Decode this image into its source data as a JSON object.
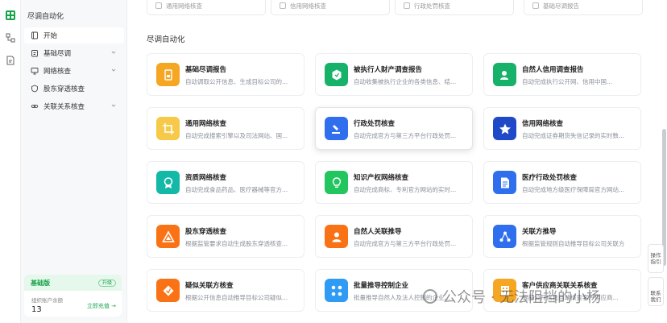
{
  "sidebar": {
    "title": "尽调自动化",
    "items": [
      {
        "label": "开始",
        "icon": "book-icon",
        "expandable": false,
        "active": true
      },
      {
        "label": "基础尽调",
        "icon": "clipboard-icon",
        "expandable": true
      },
      {
        "label": "网络核查",
        "icon": "monitor-icon",
        "expandable": true
      },
      {
        "label": "股东穿透核查",
        "icon": "shield-icon",
        "expandable": false
      },
      {
        "label": "关联关系核查",
        "icon": "link-icon",
        "expandable": true
      }
    ],
    "plan": {
      "name": "基础版",
      "upgrade": "升级",
      "balance_label": "组织账户余额",
      "balance": "13",
      "recharge": "立即充值 →"
    }
  },
  "main": {
    "top_chips": [
      "通用网络核查",
      "信用网络核查",
      "行政处罚核查",
      "基础尽调报告"
    ],
    "section_title": "尽调自动化",
    "cards": [
      {
        "title": "基础尽调报告",
        "desc": "自动调取公开信息、生成目标公司的...",
        "color": "#f5a623",
        "icon": "report-icon"
      },
      {
        "title": "被执行人财产调查报告",
        "desc": "自动收集被执行企业的各类信息、结...",
        "color": "#17b26a",
        "icon": "hexagon-icon"
      },
      {
        "title": "自然人信用调查报告",
        "desc": "自动完成执行公开网、信用中国...",
        "color": "#17b26a",
        "icon": "person-check-icon"
      },
      {
        "title": "通用网络核查",
        "desc": "自动完成搜索引擎以及司法网站、国...",
        "color": "#f7c948",
        "icon": "crop-icon"
      },
      {
        "title": "行政处罚核查",
        "desc": "自动完成官方与第三方平台行政处罚...",
        "color": "#2f6fed",
        "icon": "gavel-icon"
      },
      {
        "title": "信用网络核查",
        "desc": "自动完成证券期货失信记录的实时数...",
        "color": "#1f49c7",
        "icon": "star-icon"
      },
      {
        "title": "资质网络核查",
        "desc": "自动完成食品药品、医疗器械等官方...",
        "color": "#14b8a6",
        "icon": "award-icon"
      },
      {
        "title": "知识产权网络核查",
        "desc": "自动完成商标、专利官方网站的实时...",
        "color": "#22c55e",
        "icon": "bulb-icon"
      },
      {
        "title": "医疗行政处罚核查",
        "desc": "自动完成地方级医疗保障局官方网站...",
        "color": "#2f6fed",
        "icon": "document-icon"
      },
      {
        "title": "股东穿透核查",
        "desc": "根据监管要求自动生成股东穿透核查...",
        "color": "#f97316",
        "icon": "triangle-icon"
      },
      {
        "title": "自然人关联推导",
        "desc": "自动完成官方与第三方平台行政处罚...",
        "color": "#f97316",
        "icon": "user-icon"
      },
      {
        "title": "关联方推导",
        "desc": "根据监管规则自动推导目标公司关联方",
        "color": "#2f6fed",
        "icon": "share-icon"
      },
      {
        "title": "疑似关联方核查",
        "desc": "根据公开信息自动推导目标公司疑似...",
        "color": "#f97316",
        "icon": "diamond-icon"
      },
      {
        "title": "批量推导控制企业",
        "desc": "批量推导自然人及法人控制的企业...",
        "color": "#2f9bf5",
        "icon": "nodes-icon"
      },
      {
        "title": "客户供应商关联关系核查",
        "desc": "根据公开信息自动核查客户供应商...",
        "color": "#f5a623",
        "icon": "building-icon"
      }
    ]
  },
  "float": {
    "guide": [
      "操作",
      "指引"
    ],
    "contact": [
      "联系",
      "我们"
    ]
  },
  "watermark": "公众号 · 无法阻挡的小杨"
}
